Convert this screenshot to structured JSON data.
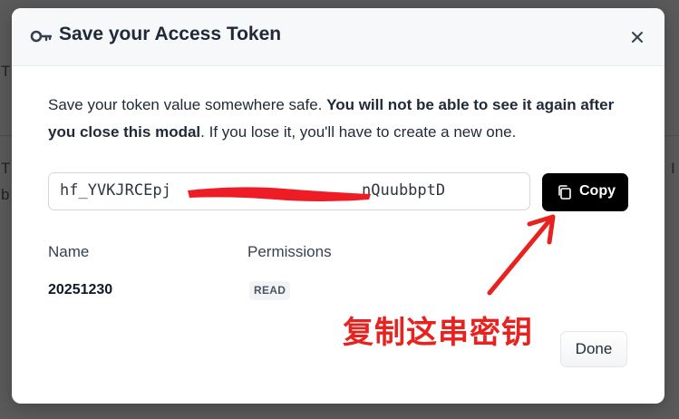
{
  "background": {
    "frag_top": "T",
    "frag_left_1": "T",
    "frag_left_2": "b",
    "frag_right": "I"
  },
  "modal": {
    "title": "Save your Access Token",
    "icons": {
      "title_icon": "key-icon",
      "close_icon": "close-icon",
      "copy_icon": "copy-icon"
    },
    "description": {
      "part1": "Save your token value somewhere safe. ",
      "bold": "You will not be able to see it again after you close this modal",
      "part2": ". If you lose it, you'll have to create a new one."
    },
    "token": {
      "visible_start": "hf_YVKJRCEpj",
      "visible_end": "nQuubbptD"
    },
    "copy_button_label": "Copy",
    "columns": {
      "name_header": "Name",
      "permissions_header": "Permissions"
    },
    "token_name": "20251230",
    "permission_badge": "READ",
    "done_button_label": "Done"
  },
  "annotation": {
    "text": "复制这串密钥",
    "color": "#e8221f"
  },
  "colors": {
    "accent_button": "#000000",
    "header_bg": "#f6f8fa",
    "overlay": "#5a5a5a"
  }
}
